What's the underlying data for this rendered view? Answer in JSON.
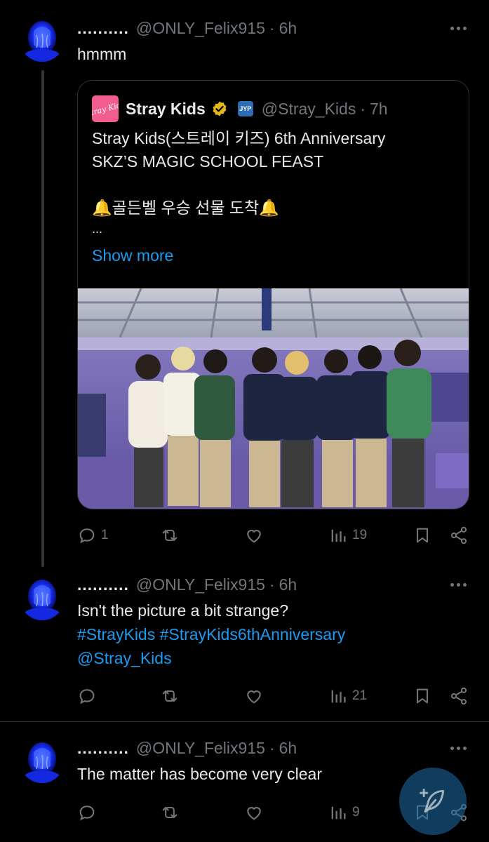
{
  "thread": [
    {
      "display_name": "..........",
      "handle": "@ONLY_Felix915",
      "separator": "·",
      "time": "6h",
      "text_lines": [
        "hmmm"
      ],
      "quote": {
        "name": "Stray Kids",
        "logo_text": "Stray Kids",
        "org_badge": "JYP",
        "handle": "@Stray_Kids",
        "separator": "·",
        "time": "7h",
        "lines": [
          "Stray Kids(스트레이 키즈) 6th Anniversary",
          "SKZ’S MAGIC SCHOOL FEAST",
          "",
          "🔔골든벨 우승 선물 도착🔔",
          "..."
        ],
        "show_more": "Show more"
      },
      "stats": {
        "replies": "1",
        "reposts": "",
        "likes": "",
        "views": "19"
      }
    },
    {
      "display_name": "..........",
      "handle": "@ONLY_Felix915",
      "separator": "·",
      "time": "6h",
      "text_line1": "Isn't the picture a bit strange?",
      "hashtag1": "#StrayKids",
      "hashtag2": "#StrayKids6thAnniversary",
      "mention": "@Stray_Kids",
      "stats": {
        "replies": "",
        "reposts": "",
        "likes": "",
        "views": "21"
      }
    },
    {
      "display_name": "..........",
      "handle": "@ONLY_Felix915",
      "separator": "·",
      "time": "6h",
      "text_line1": "The matter has become very clear",
      "stats": {
        "replies": "",
        "reposts": "",
        "likes": "",
        "views": "9"
      }
    }
  ],
  "icons": [
    "reply-icon",
    "repost-icon",
    "like-icon",
    "views-icon",
    "bookmark-icon",
    "share-icon",
    "more-icon",
    "verified-icon",
    "compose-icon"
  ],
  "colors": {
    "background": "#000000",
    "text": "#e7e9ea",
    "muted": "#71767b",
    "link": "#1d9bf0",
    "avatar_glow": "#1a36ff"
  }
}
